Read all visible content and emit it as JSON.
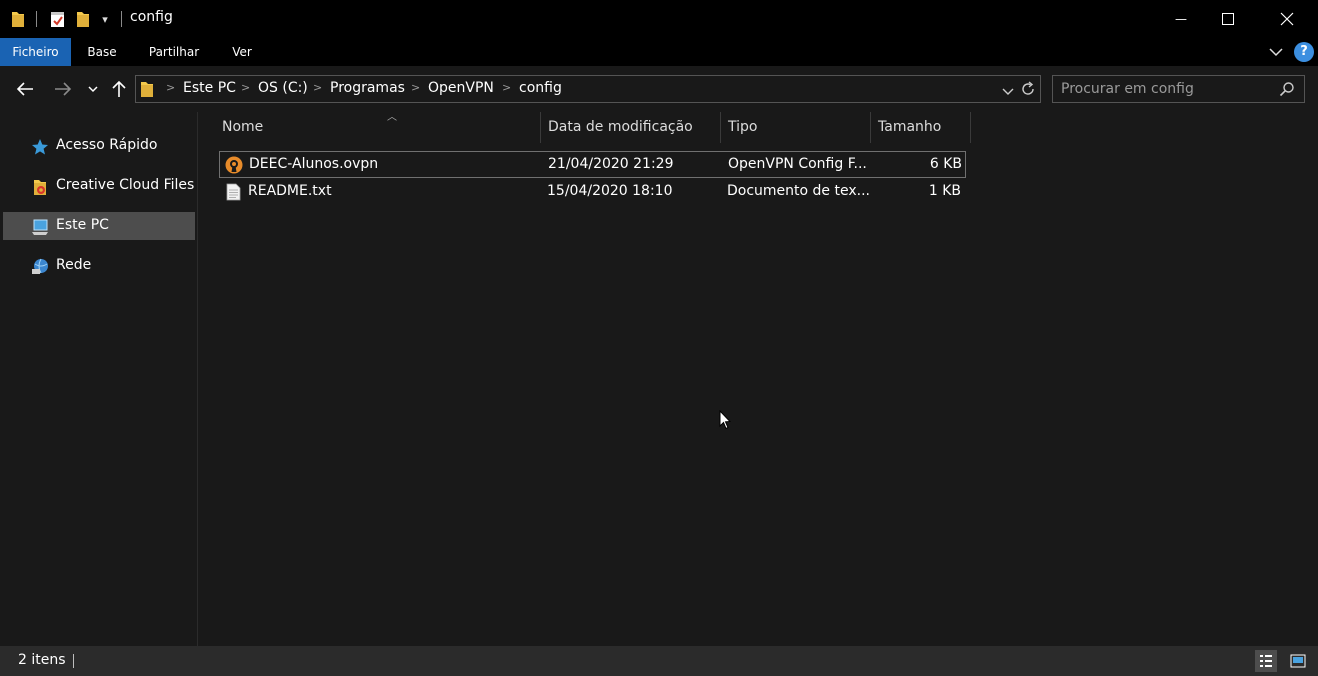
{
  "window": {
    "title": "config",
    "quick_access_dropdown": "▾",
    "minimize": "—",
    "maximize": "☐",
    "close": "✕"
  },
  "ribbon": {
    "tabs": [
      {
        "label": "Ficheiro",
        "active": true
      },
      {
        "label": "Base",
        "active": false
      },
      {
        "label": "Partilhar",
        "active": false
      },
      {
        "label": "Ver",
        "active": false
      }
    ],
    "expand_icon": "chevron-down-icon",
    "help_label": "?"
  },
  "address": {
    "crumbs": [
      "Este PC",
      "OS (C:)",
      "Programas",
      "OpenVPN",
      "config"
    ]
  },
  "search": {
    "placeholder": "Procurar em config"
  },
  "nav_pane": {
    "items": [
      {
        "label": "Acesso Rápido",
        "icon": "star-icon"
      },
      {
        "label": "Creative Cloud Files",
        "icon": "creative-cloud-folder-icon"
      },
      {
        "label": "Este PC",
        "icon": "computer-icon",
        "selected": true
      },
      {
        "label": "Rede",
        "icon": "network-icon"
      }
    ]
  },
  "file_list": {
    "columns": [
      "Nome",
      "Data de modificação",
      "Tipo",
      "Tamanho"
    ],
    "rows": [
      {
        "name": "DEEC-Alunos.ovpn",
        "date": "21/04/2020 21:29",
        "type": "OpenVPN Config F...",
        "size": "6 KB",
        "icon": "openvpn-icon"
      },
      {
        "name": "README.txt",
        "date": "15/04/2020 18:10",
        "type": "Documento de tex...",
        "size": "1 KB",
        "icon": "text-document-icon"
      }
    ]
  },
  "status": {
    "item_count": "2 itens"
  },
  "colors": {
    "accent": "#1a63b3",
    "help": "#3c8fe0",
    "background": "#191919",
    "titlebar": "#000000",
    "statusbar": "#2b2b2b",
    "folder": "#f3c94c"
  }
}
